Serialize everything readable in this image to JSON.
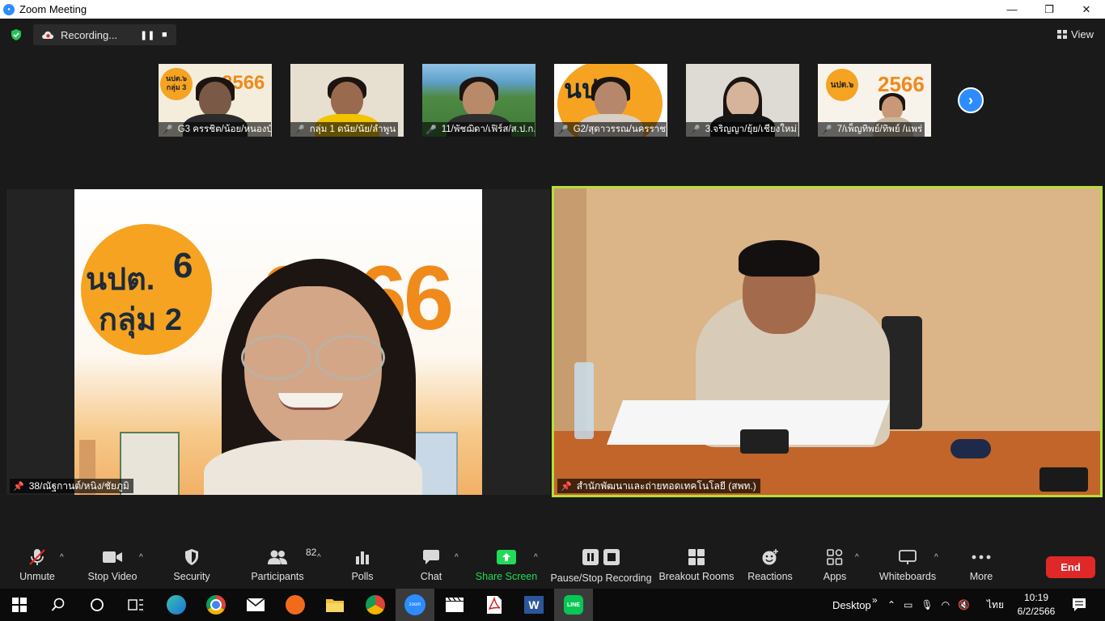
{
  "window": {
    "title": "Zoom Meeting",
    "controls": [
      "—",
      "❐",
      "✕"
    ]
  },
  "recording": {
    "status": "Recording..."
  },
  "view_label": "View",
  "gallery": [
    {
      "name": "G3 ครรชิต/น้อย/หนองบั...",
      "bg": "#f5eddc"
    },
    {
      "name": "กลุ่ม 1 ดนัย/นัย/ลำพูน",
      "bg": "#e7dfd0"
    },
    {
      "name": "11/พัชฌิดา/เฟิร์ส/ส.ป.ก....",
      "bg": "#4f8a45"
    },
    {
      "name": "G2/สุดาวรรณ/นครราชสี...",
      "bg": "#f5a321"
    },
    {
      "name": "3.จริญญา/ยุ้ย/เชียงใหม่",
      "bg": "#dedbd5"
    },
    {
      "name": "7/เพ็ญทิพย์/ทิพย์ /แพร่",
      "bg": "#f7f2ea"
    }
  ],
  "thumb_text": {
    "t1_badge": "นปต.๖ กลุ่ม 3",
    "t1_year": "2566",
    "t4_badge": "นปต",
    "t6_badge": "นปต.๖",
    "t6_year": "2566"
  },
  "speaker_left": {
    "name": "38/ณัฐกานต์/หนิง/ชัยภูมิ",
    "bg_badge_line1": "นปต.",
    "bg_badge_num": "6",
    "bg_badge_line2": "กลุ่ม 2",
    "bg_year": "2566"
  },
  "speaker_right": {
    "name": "สำนักพัฒนาและถ่ายทอดเทคโนโลยี (สพท.)"
  },
  "toolbar": {
    "unmute": "Unmute",
    "stop_video": "Stop Video",
    "security": "Security",
    "participants": "Participants",
    "participants_count": "82",
    "polls": "Polls",
    "chat": "Chat",
    "share_screen": "Share Screen",
    "pause_stop_recording": "Pause/Stop Recording",
    "breakout_rooms": "Breakout Rooms",
    "reactions": "Reactions",
    "apps": "Apps",
    "whiteboards": "Whiteboards",
    "more": "More",
    "end": "End"
  },
  "colors": {
    "accent_blue": "#2d8cff",
    "share_green": "#23d959",
    "end_red": "#e02828",
    "active_speaker": "#b7dd3b"
  },
  "taskbar": {
    "desktop_label": "Desktop",
    "language": "ไทย",
    "time": "10:19",
    "date": "6/2/2566",
    "zoom_label": "zoom"
  }
}
